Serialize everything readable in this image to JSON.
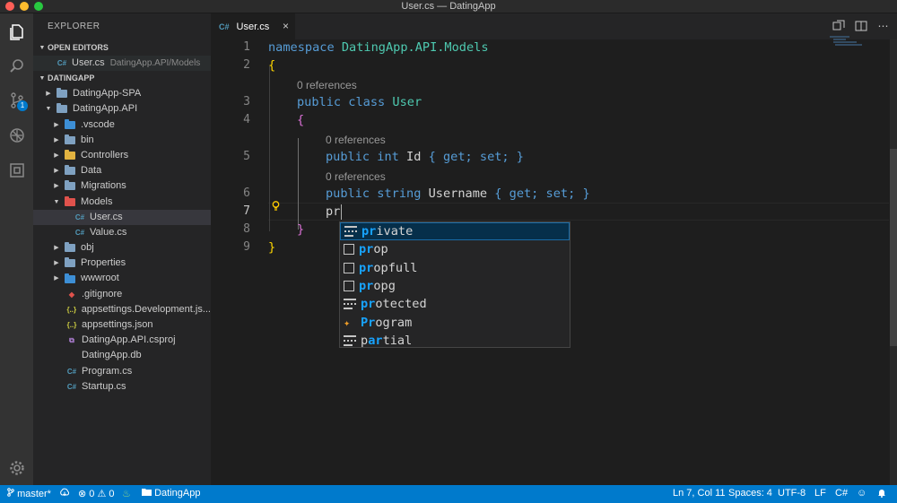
{
  "window": {
    "title": "User.cs — DatingApp"
  },
  "activity_bar": {
    "scm_badge": "1"
  },
  "sidebar": {
    "title": "EXPLORER",
    "open_editors": {
      "header": "OPEN EDITORS",
      "items": [
        {
          "icon": "C#",
          "name": "User.cs",
          "path": "DatingApp.API/Models"
        }
      ]
    },
    "workspace": {
      "header": "DATINGAPP",
      "items": [
        {
          "name": "DatingApp-SPA",
          "kind": "folder",
          "depth": 1,
          "expanded": false
        },
        {
          "name": "DatingApp.API",
          "kind": "folder",
          "depth": 1,
          "expanded": true
        },
        {
          "name": ".vscode",
          "kind": "folder-blue",
          "depth": 2,
          "expanded": false
        },
        {
          "name": "bin",
          "kind": "folder",
          "depth": 2,
          "expanded": false
        },
        {
          "name": "Controllers",
          "kind": "folder-yellow",
          "depth": 2,
          "expanded": false
        },
        {
          "name": "Data",
          "kind": "folder",
          "depth": 2,
          "expanded": false
        },
        {
          "name": "Migrations",
          "kind": "folder",
          "depth": 2,
          "expanded": false
        },
        {
          "name": "Models",
          "kind": "folder-red",
          "depth": 2,
          "expanded": true
        },
        {
          "name": "User.cs",
          "kind": "cs",
          "depth": 3,
          "selected": true
        },
        {
          "name": "Value.cs",
          "kind": "cs",
          "depth": 3
        },
        {
          "name": "obj",
          "kind": "folder",
          "depth": 2,
          "expanded": false
        },
        {
          "name": "Properties",
          "kind": "folder",
          "depth": 2,
          "expanded": false
        },
        {
          "name": "wwwroot",
          "kind": "folder-blue",
          "depth": 2,
          "expanded": false
        },
        {
          "name": ".gitignore",
          "kind": "git",
          "depth": 2
        },
        {
          "name": "appsettings.Development.js...",
          "kind": "json",
          "depth": 2
        },
        {
          "name": "appsettings.json",
          "kind": "json",
          "depth": 2
        },
        {
          "name": "DatingApp.API.csproj",
          "kind": "csproj",
          "depth": 2
        },
        {
          "name": "DatingApp.db",
          "kind": "db",
          "depth": 2
        },
        {
          "name": "Program.cs",
          "kind": "cs",
          "depth": 2
        },
        {
          "name": "Startup.cs",
          "kind": "cs",
          "depth": 2
        }
      ]
    }
  },
  "tab": {
    "icon": "C#",
    "label": "User.cs",
    "close": "×"
  },
  "editor": {
    "line_numbers": [
      "1",
      "2",
      "3",
      "4",
      "5",
      "6",
      "7",
      "8",
      "9"
    ],
    "code": {
      "l1_kw": "namespace",
      "l1_ns": "DatingApp.API.Models",
      "l2": "{",
      "ref_class": "0 references",
      "l3_kw": "public class",
      "l3_name": "User",
      "l4": "{",
      "ref_id": "0 references",
      "l5_kw": "public int",
      "l5_name": "Id",
      "l5_acc": "{ get; set; }",
      "ref_username": "0 references",
      "l6_kw": "public string",
      "l6_name": "Username",
      "l6_acc": "{ get; set; }",
      "l7": "pr",
      "l8": "}",
      "l9": "}"
    },
    "lightbulb_icon": "lightbulb"
  },
  "suggestions": [
    {
      "match": "pr",
      "rest": "ivate",
      "icon": "keyword",
      "active": true
    },
    {
      "match": "pr",
      "rest": "op",
      "icon": "snippet"
    },
    {
      "match": "pr",
      "rest": "opfull",
      "icon": "snippet"
    },
    {
      "match": "pr",
      "rest": "opg",
      "icon": "snippet"
    },
    {
      "match": "pr",
      "rest": "otected",
      "icon": "keyword"
    },
    {
      "match": "Pr",
      "rest": "ogram",
      "icon": "class"
    },
    {
      "match_pre": "p",
      "match": "ar",
      "rest": "tial",
      "icon": "keyword"
    }
  ],
  "statusbar": {
    "branch": "master*",
    "errors": "0",
    "warnings": "0",
    "project": "DatingApp",
    "position": "Ln 7, Col 11",
    "spaces": "Spaces: 4",
    "encoding": "UTF-8",
    "eol": "LF",
    "language": "C#"
  },
  "colors": {
    "status_bar": "#007acc",
    "keyword": "#569cd6",
    "type": "#4ec9b0",
    "match_highlight": "#18a3ff"
  }
}
